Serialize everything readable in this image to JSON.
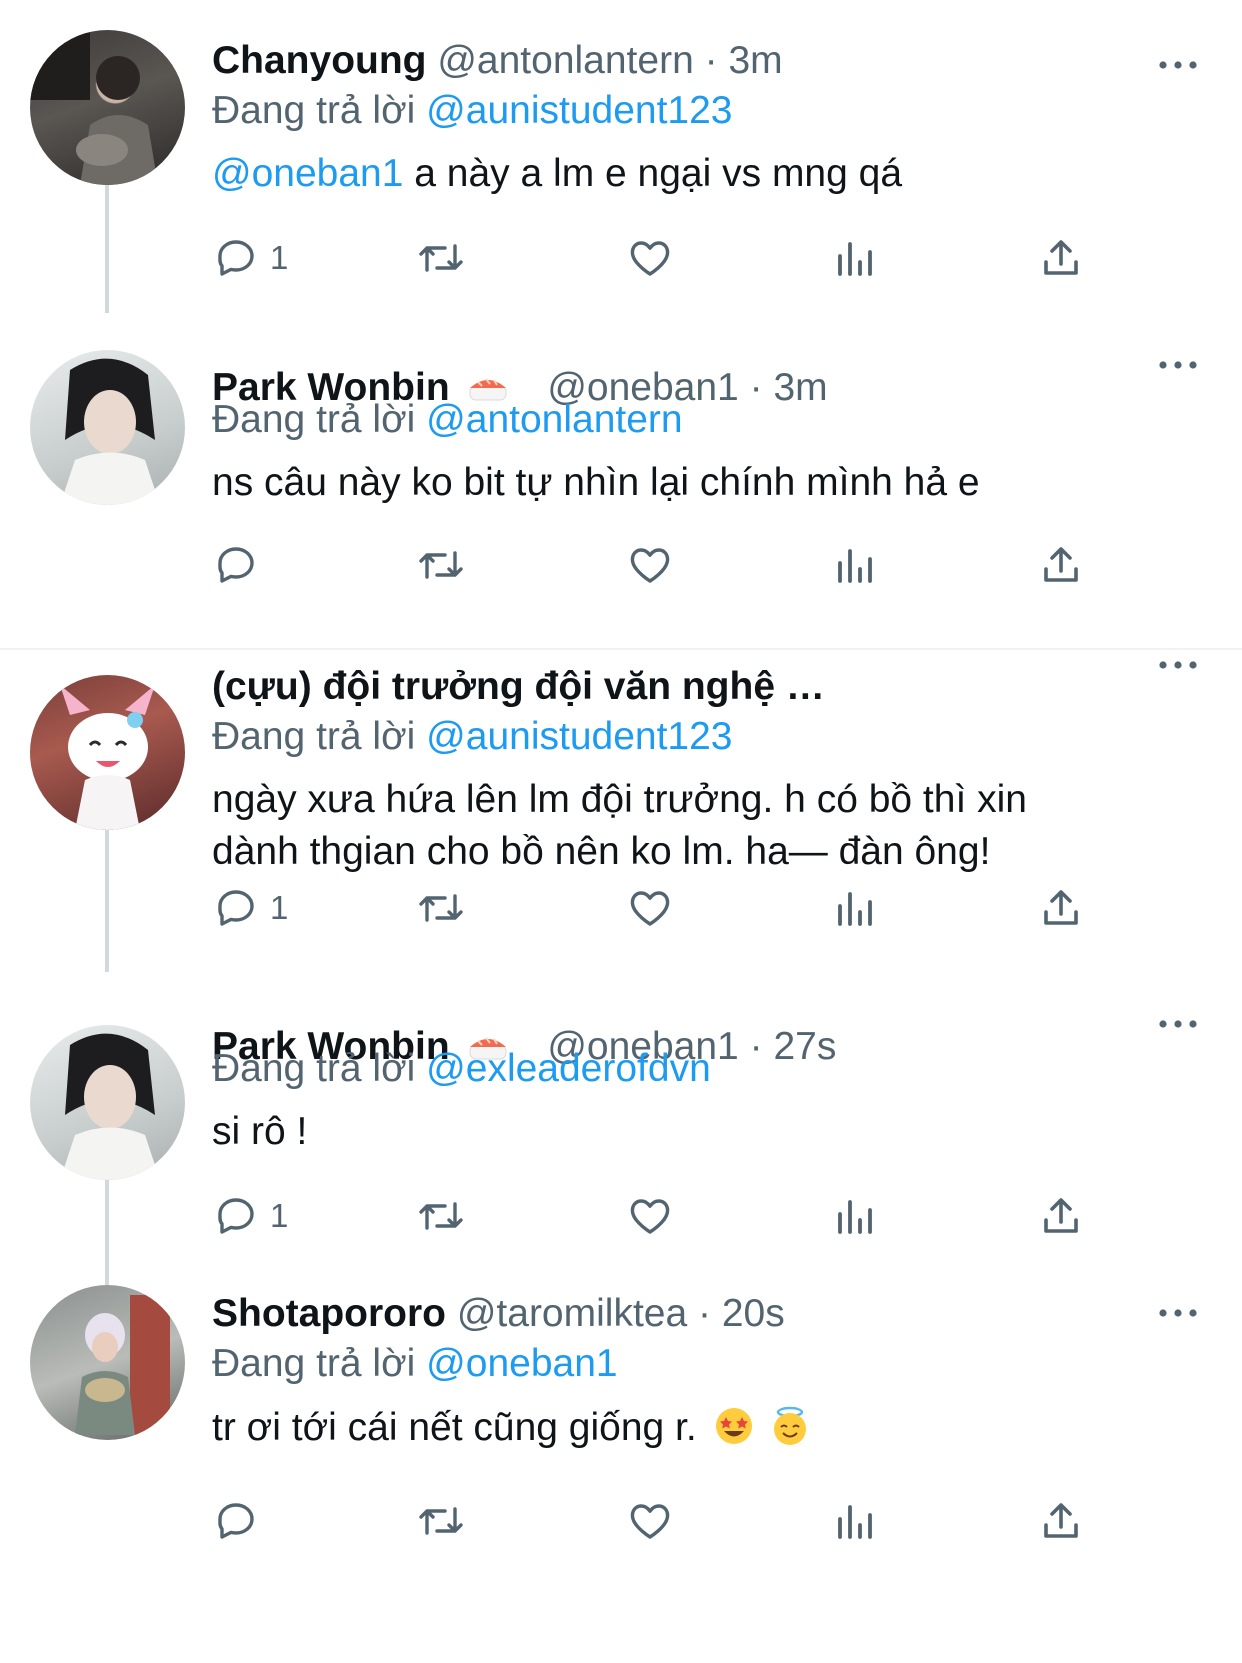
{
  "colors": {
    "link": "#1d9bf0",
    "secondary": "#536471",
    "line": "#cfd9de"
  },
  "tweets": [
    {
      "name": "Chanyoung",
      "handle": "@antonlantern",
      "sep": "·",
      "time": "3m",
      "reply_prefix": "Đang trả lời",
      "reply_to": "@aunistudent123",
      "mention": "@oneban1",
      "text": " a này a lm e ngại vs mng qá",
      "reply_count": "1"
    },
    {
      "name": "Park Wonbin",
      "handle": "@oneban1",
      "sep": "·",
      "time": "3m",
      "reply_prefix": "Đang trả lời",
      "reply_to": "@antonlantern",
      "text": "ns câu này ko bit tự nhìn lại chính mình hả e",
      "reply_count": ""
    },
    {
      "name": "(cựu) đội trưởng đội văn nghệ …",
      "reply_prefix": "Đang trả lời",
      "reply_to": "@aunistudent123",
      "text_line1": "ngày xưa hứa lên lm đội trưởng. h có bồ thì xin",
      "text_line2": "dành thgian cho bồ nên ko lm. ha— đàn ông!",
      "reply_count": "1"
    },
    {
      "name": "Park Wonbin",
      "handle": "@oneban1",
      "sep": "·",
      "time": "27s",
      "reply_prefix": "Đang trả lời",
      "reply_to": "@exleaderofdvn",
      "text": "si rô !",
      "reply_count": "1"
    },
    {
      "name": "Shotapororo",
      "handle": "@taromilktea",
      "sep": "·",
      "time": "20s",
      "reply_prefix": "Đang trả lời",
      "reply_to": "@oneban1",
      "text": "tr ơi tới cái nết cũng giống r.",
      "reply_count": ""
    }
  ],
  "icons": [
    "reply-icon",
    "retweet-icon",
    "like-icon",
    "views-icon",
    "share-icon",
    "more-icon",
    "sushi-emoji",
    "star-struck-emoji",
    "halo-emoji"
  ]
}
